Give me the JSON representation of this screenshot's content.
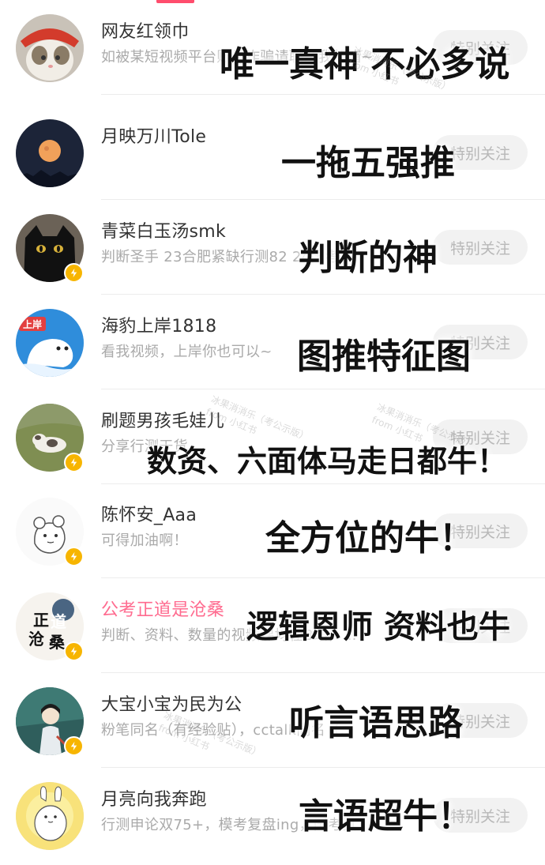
{
  "rows": [
    {
      "username": "网友红领巾",
      "description": "如被某短视频平台账号诈骗请联系我邮箱~",
      "follow_label": "特别关注",
      "overlay": "唯一真神 不必多说",
      "verified": false
    },
    {
      "username": "月映万川Tole",
      "description": "",
      "follow_label": "特别关注",
      "overlay": "一拖五强推",
      "verified": false
    },
    {
      "username": "青菜白玉汤smk",
      "description": "判断圣手 23合肥紧缺行测82 24国考…",
      "follow_label": "特别关注",
      "overlay": "判断的神",
      "verified": true
    },
    {
      "username": "海豹上岸1818",
      "description": "看我视频，上岸你也可以~",
      "follow_label": "特别关注",
      "overlay": "图推特征图",
      "verified": false,
      "avatar_text": "上岸"
    },
    {
      "username": "刷题男孩毛娃儿",
      "description": "分享行测干货",
      "follow_label": "特别关注",
      "overlay": "数资、六面体马走日都牛！",
      "verified": true
    },
    {
      "username": "陈怀安_Aaa",
      "description": "可得加油啊！",
      "follow_label": "特别关注",
      "overlay": "全方位的牛！",
      "verified": true
    },
    {
      "username": "公考正道是沧桑",
      "description": "判断、资料、数量的视频课均在B站，…",
      "follow_label": "特别关注",
      "overlay": "逻辑恩师 资料也牛",
      "verified": true,
      "highlight": true,
      "avatar_text": "正道沧桑"
    },
    {
      "username": "大宝小宝为民为公",
      "description": "粉笔同名（有经验贴），cctalk同名（…",
      "follow_label": "特别关注",
      "overlay": "听言语思路",
      "verified": true
    },
    {
      "username": "月亮向我奔跑",
      "description": "行测申论双75+，模考复盘ing，国考真…",
      "follow_label": "特别关注",
      "overlay": "言语超牛！",
      "verified": false
    }
  ],
  "watermark": {
    "line1": "冰果消消乐（考公示版）",
    "line2": "from 小红书"
  },
  "colors": {
    "accent": "#ff4d6d",
    "badge": "#f7b500",
    "highlight_name": "#ff6b8f"
  }
}
